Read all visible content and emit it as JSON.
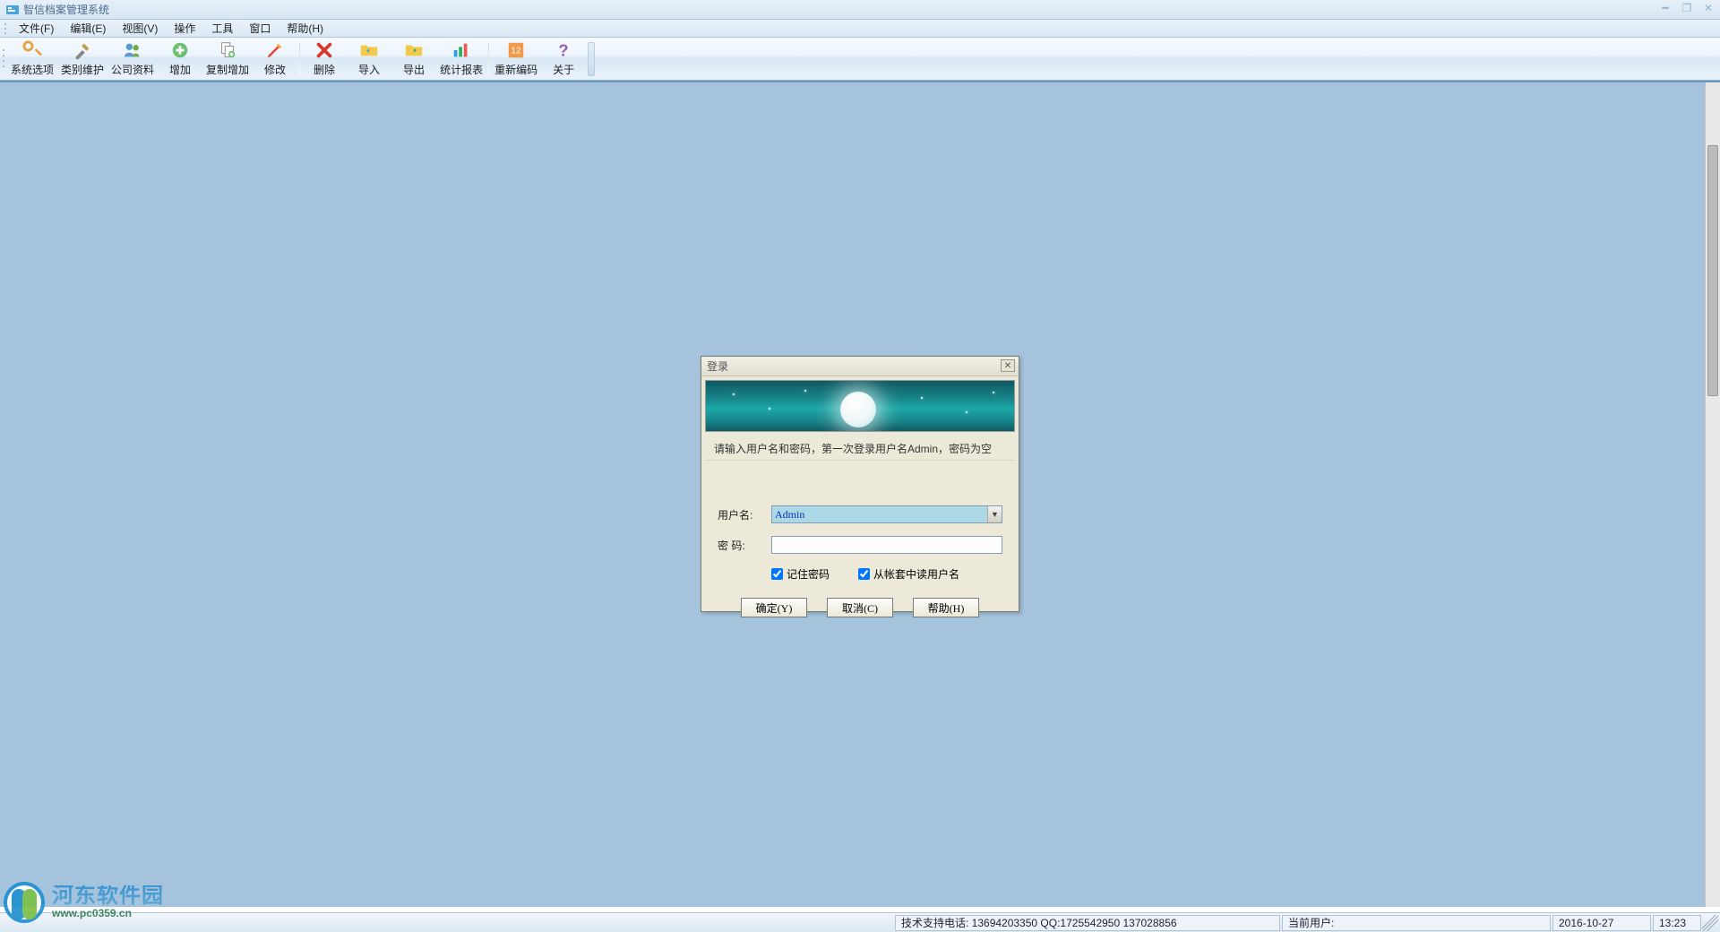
{
  "title": "智信档案管理系统",
  "menu": {
    "items": [
      {
        "label": "文件(F)"
      },
      {
        "label": "编辑(E)"
      },
      {
        "label": "视图(V)"
      },
      {
        "label": "操作"
      },
      {
        "label": "工具"
      },
      {
        "label": "窗口"
      },
      {
        "label": "帮助(H)"
      }
    ]
  },
  "toolbar": {
    "items": [
      {
        "label": "系统选项",
        "icon": "wrench"
      },
      {
        "label": "类别维护",
        "icon": "tools"
      },
      {
        "label": "公司资料",
        "icon": "users"
      },
      {
        "label": "增加",
        "icon": "plus"
      },
      {
        "label": "复制增加",
        "icon": "copy"
      },
      {
        "label": "修改",
        "icon": "pencil"
      },
      {
        "label": "删除",
        "icon": "delete"
      },
      {
        "label": "导入",
        "icon": "folder-in"
      },
      {
        "label": "导出",
        "icon": "folder-out"
      },
      {
        "label": "统计报表",
        "icon": "chart"
      },
      {
        "label": "重新编码",
        "icon": "renumber"
      },
      {
        "label": "关于",
        "icon": "help"
      }
    ]
  },
  "login": {
    "dialog_title": "登录",
    "hint": "请输入用户名和密码，第一次登录用户名Admin，密码为空",
    "user_label": "用户名:",
    "user_value": "Admin",
    "pwd_label": "密  码:",
    "pwd_value": "",
    "remember_label": "记住密码",
    "remember_checked": true,
    "read_from_book_label": "从帐套中读用户名",
    "read_from_book_checked": true,
    "ok_label": "确定(Y)",
    "cancel_label": "取消(C)",
    "help_label": "帮助(H)"
  },
  "status": {
    "support": "技术支持电话: 13694203350 QQ:1725542950 137028856",
    "current_user_label": "当前用户:",
    "date": "2016-10-27",
    "time": "13:23"
  },
  "watermark": {
    "line1": "河东软件园",
    "line2": "www.pc0359.cn"
  },
  "icons": {
    "wrench": "🔧",
    "tools": "🛠",
    "users": "👥",
    "plus": "➕",
    "copy": "📑",
    "pencil": "✏️",
    "delete": "✖",
    "folder-in": "📂",
    "folder-out": "📤",
    "chart": "📊",
    "renumber": "🔢",
    "help": "❓"
  },
  "colors": {
    "client_bg": "#a5c3dc",
    "accent": "#1d8ecf"
  }
}
